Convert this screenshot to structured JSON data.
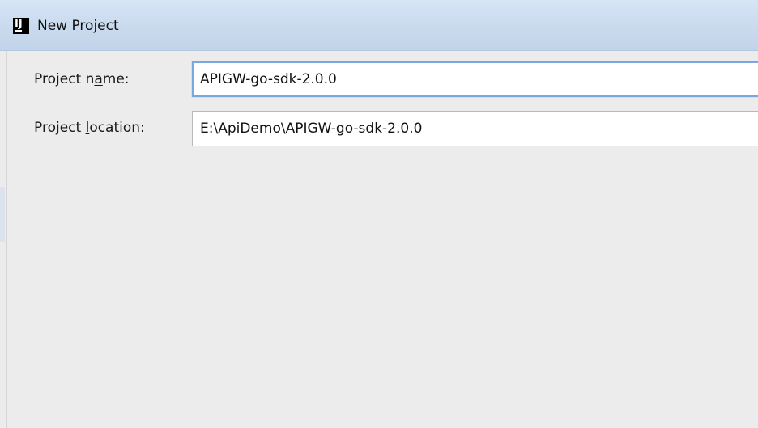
{
  "window": {
    "title": "New Project",
    "icon": "intellij-icon",
    "icon_text": "IJ"
  },
  "form": {
    "project_name": {
      "label_before": "Project n",
      "label_mnemonic": "a",
      "label_after": "me:",
      "value": "APIGW-go-sdk-2.0.0"
    },
    "project_location": {
      "label_before": "Project ",
      "label_mnemonic": "l",
      "label_after": "ocation:",
      "value": "E:\\ApiDemo\\APIGW-go-sdk-2.0.0"
    }
  },
  "colors": {
    "titlebar": "#c9daee",
    "background": "#ececec",
    "focus_border": "#7aa7e0"
  }
}
